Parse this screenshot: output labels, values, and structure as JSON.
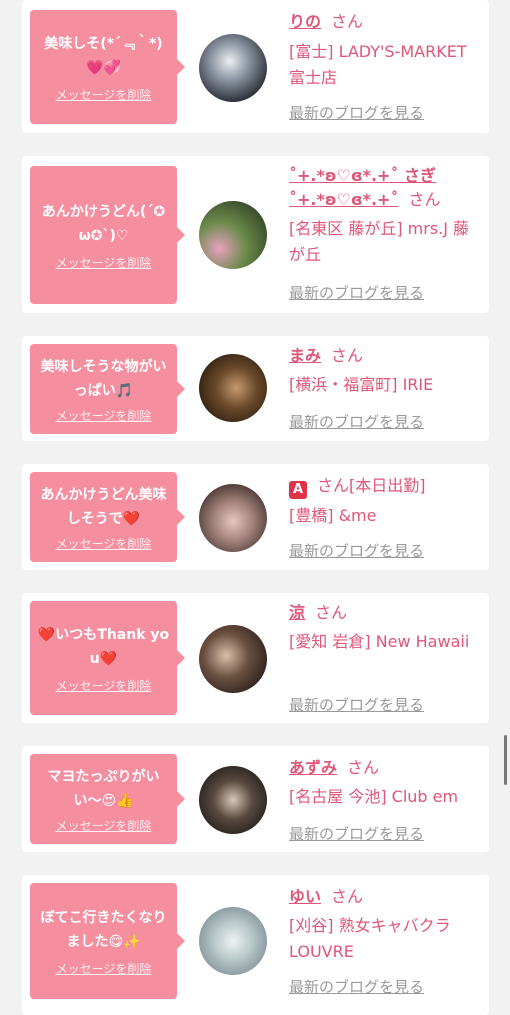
{
  "labels": {
    "delete": "メッセージを削除",
    "san": "さん",
    "blog": "最新のブログを見る"
  },
  "colors": {
    "bubble": "#f58fa0",
    "accent": "#e0557a",
    "muted": "#999999",
    "background": "#f2f2f2"
  },
  "cards": [
    {
      "message": "美味しそ(*´﹃｀*)💗💞",
      "name": "りの",
      "shop": "[富士] LADY'S-MARKET 富士店"
    },
    {
      "message": "あんかけうどん(´✪ω✪`)♡",
      "name": "˚+.*ʚ♡ɞ*.+˚ さぎ˚+.*ʚ♡ɞ*.+˚",
      "shop": "[名東区 藤が丘] mrs.J 藤が丘"
    },
    {
      "message": "美味しそうな物がいっぱい🎵",
      "name": "まみ",
      "shop": "[横浜・福富町] IRIE"
    },
    {
      "message": "あんかけうどん美味しそうで❤️",
      "name": "🅰️",
      "name_extra": "[本日出勤]",
      "shop": "[豊橋] &me"
    },
    {
      "message": "❤️いつもThank you❤️",
      "name": "涼",
      "shop": "[愛知 岩倉] New Hawaii"
    },
    {
      "message": "マヨたっぷりがいい〜😍👍",
      "name": "あずみ",
      "shop": "[名古屋 今池] Club em"
    },
    {
      "message": "ぼてこ行きたくなりました😋✨",
      "name": "ゆい",
      "shop": "[刈谷] 熟女キャバクラ LOUVRE"
    }
  ]
}
